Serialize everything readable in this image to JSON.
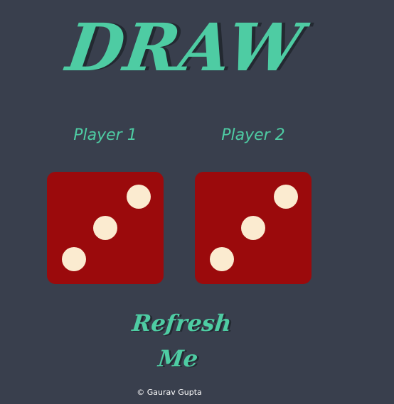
{
  "header": {
    "title": "DRAW"
  },
  "players": [
    {
      "label": "Player 1",
      "die_value": 3
    },
    {
      "label": "Player 2",
      "die_value": 3
    }
  ],
  "refresh_button": {
    "label": "Refresh Me"
  },
  "footer": {
    "credit": "© Gaurav Gupta"
  },
  "colors": {
    "background": "#393f4d",
    "accent": "#4ecca3",
    "die_face": "#9b0a0c",
    "pip": "#fbebd0"
  }
}
